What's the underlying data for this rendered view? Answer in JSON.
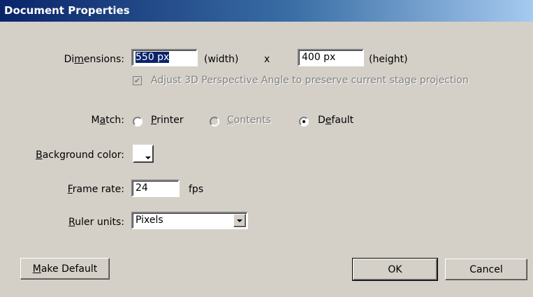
{
  "window": {
    "title": "Document Properties"
  },
  "dimensions": {
    "label_pre": "Di",
    "label_u": "m",
    "label_post": "ensions:",
    "width_value": "550 px",
    "width_unit": "(width)",
    "times": "x",
    "height_value": "400 px",
    "height_unit": "(height)"
  },
  "adjust_3d": {
    "label": "Adjust 3D Perspective Angle to preserve current stage projection",
    "checked": true,
    "disabled": true
  },
  "match": {
    "label_pre": "M",
    "label_u": "a",
    "label_post": "tch:",
    "options": [
      {
        "pre": "",
        "u": "P",
        "post": "rinter",
        "selected": false,
        "disabled": false
      },
      {
        "pre": "",
        "u": "C",
        "post": "ontents",
        "selected": false,
        "disabled": true
      },
      {
        "pre": "D",
        "u": "e",
        "post": "fault",
        "selected": true,
        "disabled": false
      }
    ]
  },
  "background": {
    "label_pre": "",
    "label_u": "B",
    "label_post": "ackground color:",
    "color": "#ffffff"
  },
  "frame_rate": {
    "label_pre": "",
    "label_u": "F",
    "label_post": "rame rate:",
    "value": "24",
    "unit": "fps"
  },
  "ruler": {
    "label_pre": "",
    "label_u": "R",
    "label_post": "uler units:",
    "value": "Pixels"
  },
  "buttons": {
    "make_default_u": "M",
    "make_default_post": "ake Default",
    "ok": "OK",
    "cancel": "Cancel"
  },
  "colors": {
    "dialog_bg": "#d4d0c8",
    "title_start": "#0a246a",
    "title_end": "#a6caf0",
    "selection": "#0a246a"
  }
}
